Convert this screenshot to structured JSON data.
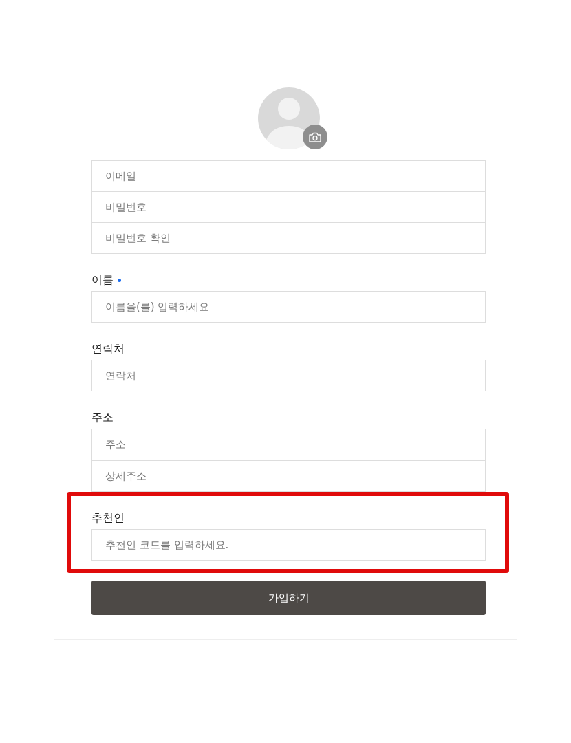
{
  "account_fields": [
    {
      "placeholder": "이메일"
    },
    {
      "placeholder": "비밀번호"
    },
    {
      "placeholder": "비밀번호 확인"
    }
  ],
  "sections": [
    {
      "label": "이름",
      "required": true,
      "highlighted": false,
      "fields": [
        {
          "placeholder": "이름을(를) 입력하세요"
        }
      ]
    },
    {
      "label": "연락처",
      "required": false,
      "highlighted": false,
      "fields": [
        {
          "placeholder": "연락처"
        }
      ]
    },
    {
      "label": "주소",
      "required": false,
      "highlighted": false,
      "fields": [
        {
          "placeholder": "주소"
        },
        {
          "placeholder": "상세주소"
        }
      ]
    },
    {
      "label": "추천인",
      "required": false,
      "highlighted": true,
      "fields": [
        {
          "placeholder": "추천인 코드를 입력하세요."
        }
      ]
    }
  ],
  "submit_button": {
    "label": "가입하기"
  }
}
